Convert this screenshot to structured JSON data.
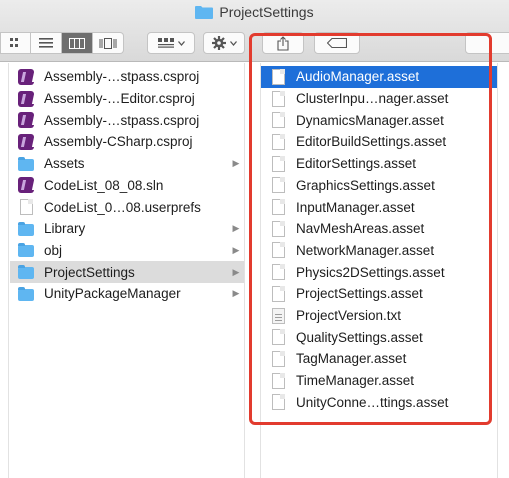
{
  "window": {
    "title": "ProjectSettings"
  },
  "toolbar": {
    "view_buttons": [
      "icon-view",
      "list-view",
      "column-view",
      "cover-flow-view"
    ],
    "active_view": "column-view",
    "group_button": "group-menu",
    "action_button": "action-menu"
  },
  "column_2": {
    "items": [
      {
        "label": "Assembly-…stpass.csproj",
        "icon": "visual-studio-icon",
        "has_children": false
      },
      {
        "label": "Assembly-…Editor.csproj",
        "icon": "visual-studio-icon",
        "has_children": false
      },
      {
        "label": "Assembly-…stpass.csproj",
        "icon": "visual-studio-icon",
        "has_children": false
      },
      {
        "label": "Assembly-CSharp.csproj",
        "icon": "visual-studio-icon",
        "has_children": false
      },
      {
        "label": "Assets",
        "icon": "folder-icon",
        "has_children": true
      },
      {
        "label": "CodeList_08_08.sln",
        "icon": "visual-studio-icon",
        "has_children": false
      },
      {
        "label": "CodeList_0…08.userprefs",
        "icon": "document-icon",
        "has_children": false
      },
      {
        "label": "Library",
        "icon": "folder-icon",
        "has_children": true
      },
      {
        "label": "obj",
        "icon": "folder-icon",
        "has_children": true
      },
      {
        "label": "ProjectSettings",
        "icon": "folder-icon",
        "has_children": true,
        "selected": true
      },
      {
        "label": "UnityPackageManager",
        "icon": "folder-icon",
        "has_children": true
      }
    ]
  },
  "column_3": {
    "items": [
      {
        "label": "AudioManager.asset",
        "icon": "document-icon",
        "selected": true
      },
      {
        "label": "ClusterInpu…nager.asset",
        "icon": "document-icon"
      },
      {
        "label": "DynamicsManager.asset",
        "icon": "document-icon"
      },
      {
        "label": "EditorBuildSettings.asset",
        "icon": "document-icon"
      },
      {
        "label": "EditorSettings.asset",
        "icon": "document-icon"
      },
      {
        "label": "GraphicsSettings.asset",
        "icon": "document-icon"
      },
      {
        "label": "InputManager.asset",
        "icon": "document-icon"
      },
      {
        "label": "NavMeshAreas.asset",
        "icon": "document-icon"
      },
      {
        "label": "NetworkManager.asset",
        "icon": "document-icon"
      },
      {
        "label": "Physics2DSettings.asset",
        "icon": "document-icon"
      },
      {
        "label": "ProjectSettings.asset",
        "icon": "document-icon"
      },
      {
        "label": "ProjectVersion.txt",
        "icon": "text-file-icon"
      },
      {
        "label": "QualitySettings.asset",
        "icon": "document-icon"
      },
      {
        "label": "TagManager.asset",
        "icon": "document-icon"
      },
      {
        "label": "TimeManager.asset",
        "icon": "document-icon"
      },
      {
        "label": "UnityConne…ttings.asset",
        "icon": "document-icon"
      }
    ]
  },
  "colors": {
    "selection_blue": "#1e6fd9",
    "selection_grey": "#dcdcdc",
    "highlight_box": "#e23b2e",
    "folder": "#5fb6f1"
  }
}
